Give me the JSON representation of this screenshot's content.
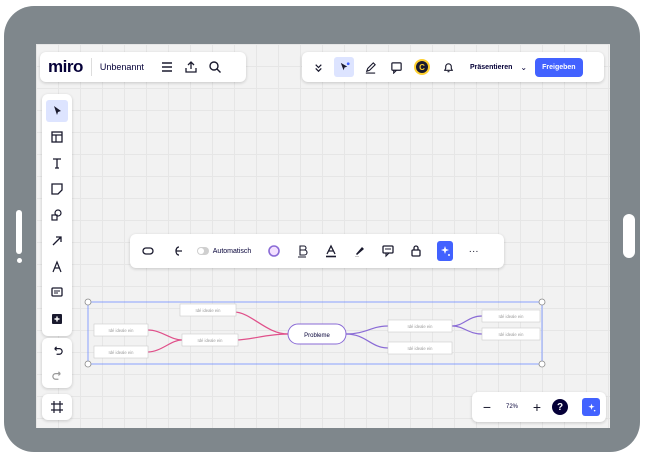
{
  "app": {
    "logo": "miro",
    "board_name": "Unbenannt"
  },
  "header_left": {
    "icons": [
      "menu-icon",
      "export-icon",
      "search-icon"
    ]
  },
  "header_right": {
    "icons": [
      "double-chevron-icon",
      "reactions-cursor-icon",
      "pen-icon",
      "comment-icon",
      "avatar",
      "bell-icon"
    ],
    "avatar_initial": "C",
    "present_label": "Präsentieren",
    "present_dropdown": "⌄",
    "share_label": "Freigeben"
  },
  "left_toolbar": {
    "tools": [
      "select-icon",
      "templates-icon",
      "text-icon",
      "sticky-note-icon",
      "shapes-icon",
      "arrow-icon",
      "pen-icon",
      "comment-icon",
      "add-icon"
    ],
    "active": "select-icon",
    "undo": "undo-icon",
    "redo": "redo-icon",
    "frames": "frames-icon"
  },
  "context_toolbar": {
    "auto_label": "Automatisch",
    "icons": [
      "shape-icon",
      "branch-icon",
      "toggle",
      "fill-color-icon",
      "text-style-icon",
      "text-color-icon",
      "highlight-icon",
      "comment-icon",
      "lock-icon",
      "ai-icon",
      "more-icon"
    ],
    "more": "···"
  },
  "zoom": {
    "minus": "−",
    "value": "72%",
    "plus": "+",
    "help": "?"
  },
  "mindmap": {
    "center": "Probleme",
    "placeholder": "Idé ideale ein"
  },
  "colors": {
    "accent": "#4262ff",
    "branch_left": "#e0508a",
    "branch_right": "#8a6bd6",
    "selection": "#6f8cff"
  }
}
